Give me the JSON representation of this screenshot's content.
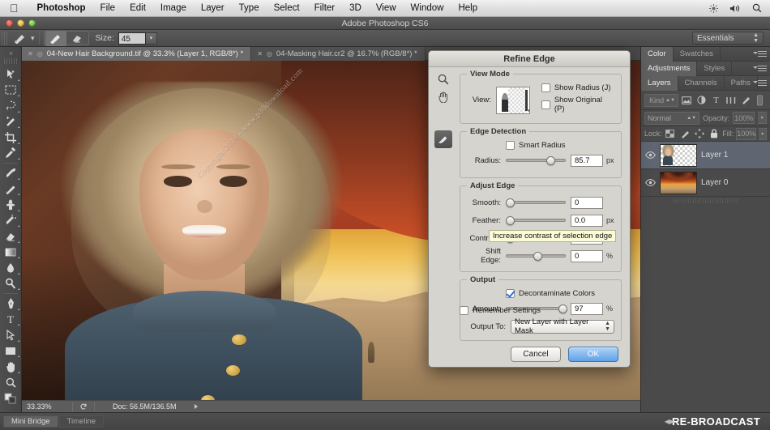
{
  "macbar": {
    "apple_icon": "apple-logo",
    "items": [
      {
        "label": "Photoshop",
        "bold": true
      },
      {
        "label": "File",
        "bold": false
      },
      {
        "label": "Edit",
        "bold": false
      },
      {
        "label": "Image",
        "bold": false
      },
      {
        "label": "Layer",
        "bold": false
      },
      {
        "label": "Type",
        "bold": false
      },
      {
        "label": "Select",
        "bold": false
      },
      {
        "label": "Filter",
        "bold": false
      },
      {
        "label": "3D",
        "bold": false
      },
      {
        "label": "View",
        "bold": false
      },
      {
        "label": "Window",
        "bold": false
      },
      {
        "label": "Help",
        "bold": false
      }
    ],
    "status_icons": [
      "brightness-icon",
      "volume-icon",
      "search-icon"
    ]
  },
  "window": {
    "title": "Adobe Photoshop CS6"
  },
  "options_bar": {
    "tool_icon": "brush-tool-icon",
    "preset_icon": "brush-preset-icon",
    "mode_icons": [
      "brush-icon",
      "eraser-icon"
    ],
    "size_label": "Size:",
    "size_value": "45",
    "workspace": "Essentials"
  },
  "toolbar": {
    "tools": [
      "move-tool-icon",
      "rectangular-marquee-icon",
      "lasso-icon",
      "quick-selection-icon",
      "crop-icon",
      "eyedropper-icon",
      "spot-healing-brush-icon",
      "brush-icon",
      "clone-stamp-icon",
      "history-brush-icon",
      "eraser-icon",
      "gradient-icon",
      "blur-icon",
      "dodge-icon",
      "pen-icon",
      "type-tool-icon",
      "path-selection-icon",
      "rectangle-shape-icon",
      "hand-tool-icon",
      "zoom-tool-icon"
    ]
  },
  "tabs": [
    {
      "title": "04-New Hair Background.tif @ 33.3% (Layer 1, RGB/8*) *",
      "active": true,
      "close_icon": "close-icon"
    },
    {
      "title": "04-Masking Hair.cr2 @ 16.7% (RGB/8*) *",
      "active": false,
      "close_icon": "close-icon"
    }
  ],
  "canvas": {
    "watermark": "Copyright  2014 - www.p30download.com",
    "cursor_icon": "arrow-cursor-icon"
  },
  "statusbar": {
    "zoom": "33.33%",
    "doc_info": "Doc: 56.5M/136.5M"
  },
  "bottom_dock": {
    "tabs": [
      "Mini Bridge",
      "Timeline"
    ],
    "badge": "RE-BROADCAST"
  },
  "panels": {
    "row1": [
      {
        "label": "Color",
        "active": true
      },
      {
        "label": "Swatches",
        "active": false
      }
    ],
    "row2": [
      {
        "label": "Adjustments",
        "active": true
      },
      {
        "label": "Styles",
        "active": false
      }
    ],
    "row3": [
      {
        "label": "Layers",
        "active": true
      },
      {
        "label": "Channels",
        "active": false
      },
      {
        "label": "Paths",
        "active": false
      }
    ],
    "filter": {
      "kind_label": "Kind",
      "search_icon": "search-icon",
      "icons": [
        "image-filter-icon",
        "adjustment-filter-icon",
        "type-filter-icon",
        "shape-filter-icon",
        "smart-object-filter-icon"
      ],
      "toggle_icon": "filter-toggle-icon"
    },
    "blend": {
      "mode": "Normal",
      "opacity_label": "Opacity:",
      "opacity_value": "100%"
    },
    "lock": {
      "label": "Lock:",
      "icons": [
        "lock-transparent-icon",
        "lock-image-icon",
        "lock-position-icon",
        "lock-all-icon"
      ],
      "fill_label": "Fill:",
      "fill_value": "100%"
    },
    "layers": [
      {
        "name": "Layer 1",
        "visible": true,
        "selected": true,
        "eye_icon": "eye-icon",
        "thumb": "person-cutout"
      },
      {
        "name": "Layer 0",
        "visible": true,
        "selected": false,
        "eye_icon": "eye-icon",
        "thumb": "landscape"
      }
    ]
  },
  "dialog": {
    "title": "Refine Edge",
    "tools": [
      "zoom-tool-icon",
      "hand-tool-icon",
      "refine-radius-brush-icon"
    ],
    "view_mode": {
      "legend": "View Mode",
      "view_label": "View:",
      "thumb_icon": "view-mode-thumbnail",
      "checkboxes": [
        {
          "label": "Show Radius (J)",
          "checked": false
        },
        {
          "label": "Show Original (P)",
          "checked": false
        }
      ]
    },
    "edge_detection": {
      "legend": "Edge Detection",
      "smart_radius": {
        "label": "Smart Radius",
        "checked": false
      },
      "radius": {
        "label": "Radius:",
        "value": "85.7",
        "unit": "px",
        "knob_pct": 72
      }
    },
    "adjust_edge": {
      "legend": "Adjust Edge",
      "rows": [
        {
          "label": "Smooth:",
          "value": "0",
          "unit": "",
          "knob_pct": 0
        },
        {
          "label": "Feather:",
          "value": "0.0",
          "unit": "px",
          "knob_pct": 0
        },
        {
          "label": "Contrast:",
          "value": "0",
          "unit": "%",
          "knob_pct": 0
        },
        {
          "label": "Shift Edge:",
          "value": "0",
          "unit": "%",
          "knob_pct": 50
        }
      ]
    },
    "tooltip": "Increase contrast of selection edge",
    "output": {
      "legend": "Output",
      "decontaminate": {
        "label": "Decontaminate Colors",
        "checked": true
      },
      "amount": {
        "label": "Amount:",
        "value": "97",
        "unit": "%",
        "knob_pct": 91
      },
      "output_to_label": "Output To:",
      "output_to_value": "New Layer with Layer Mask"
    },
    "remember": {
      "label": "Remember Settings",
      "checked": false
    },
    "buttons": {
      "cancel": "Cancel",
      "ok": "OK"
    }
  }
}
